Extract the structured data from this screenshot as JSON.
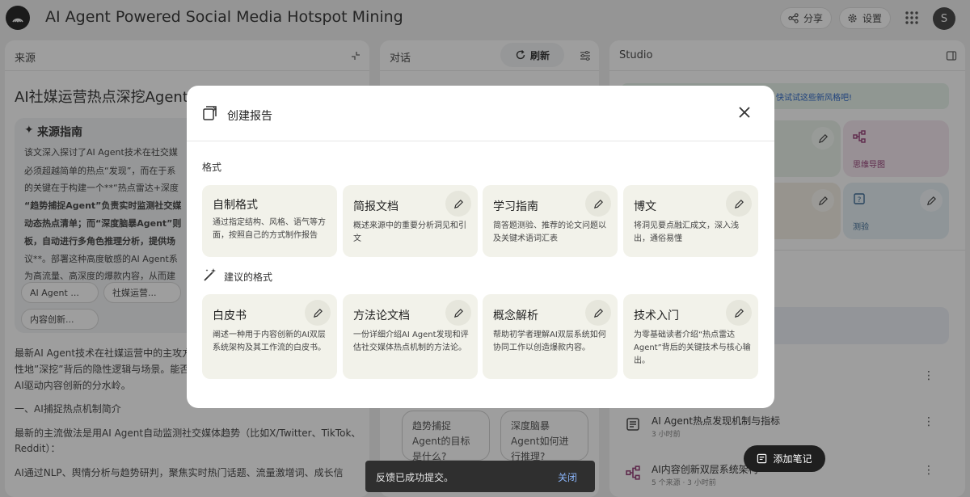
{
  "app": {
    "title": "AI Agent Powered Social Media Hotspot Mining",
    "share_label": "分享",
    "settings_label": "设置",
    "avatar_letter": "S"
  },
  "sources": {
    "panel_title": "来源",
    "doc_title": "AI社媒运营热点深挖Agent",
    "guide_title": "来源指南",
    "guide_lines": [
      "该文深入探讨了AI Agent技术在社交媒",
      "必须超越简单的热点“发现”，而在于系",
      "的关键在于构建一个**“热点雷达+深度",
      "“趋势捕捉Agent”负责实时监测社交媒",
      "动态热点清单；而“深度脑暴Agent”则",
      "板，自动进行多角色推理分析，提供场",
      "议**。部署这种高度敏感的AI Agent系",
      "为高流量、高深度的爆款内容，从而建"
    ],
    "chips": [
      "AI Agent ...",
      "社媒运营...",
      "内容创新..."
    ],
    "paragraphs": [
      "最新AI Agent技术在社媒运营中的主攻方向",
      "性地”深挖”背后的隐性逻辑与场景。能否",
      "AI驱动内容创新的分水岭。",
      "一、AI捕捉热点机制简介",
      "最新的主流做法是用AI Agent自动监测社交媒体趋势（比如X/Twitter、TikTok、",
      "Reddit）：",
      "AI通过NLP、舆情分析与趋势研判，聚焦实时热门话题、流量激增词、成长信"
    ]
  },
  "chat": {
    "panel_title": "对话",
    "refresh_label": "刷新",
    "suggestions": [
      "趋势捕捉 Agent的目标是什么?",
      "深度脑暴 Agent如何进行推理?"
    ]
  },
  "studio": {
    "panel_title": "Studio",
    "banner_text": "快试试这些新风格吧!",
    "tiles": [
      {
        "label": "思维导图"
      },
      {
        "label": "测验"
      }
    ],
    "notes": [
      {
        "title": "AI Agent热点发现机制与指标",
        "sub": "3 小时前"
      },
      {
        "title": "AI内容创新双层系统架构",
        "sub": "5 个来源 · 3 小时前"
      }
    ],
    "add_note_label": "添加笔记"
  },
  "modal": {
    "title": "创建报告",
    "section_format": "格式",
    "section_suggested": "建议的格式",
    "formats": [
      {
        "title": "自制格式",
        "desc": "通过指定结构、风格、语气等方面，按照自己的方式制作报告"
      },
      {
        "title": "简报文档",
        "desc": "概述来源中的重要分析洞见和引文"
      },
      {
        "title": "学习指南",
        "desc": "简答题测验、推荐的论文问题以及关键术语词汇表"
      },
      {
        "title": "博文",
        "desc": "将洞见要点融汇成文，深入浅出，通俗易懂"
      }
    ],
    "suggested": [
      {
        "title": "白皮书",
        "desc": "阐述一种用于内容创新的AI双层系统架构及其工作流的白皮书。"
      },
      {
        "title": "方法论文档",
        "desc": "一份详细介绍AI Agent发现和评估社交媒体热点机制的方法论。"
      },
      {
        "title": "概念解析",
        "desc": "帮助初学者理解AI双层系统如何协同工作以创造爆款内容。"
      },
      {
        "title": "技术入门",
        "desc": "为零基础读者介绍“热点雷达Agent”背后的关键技术与核心输出。"
      }
    ]
  },
  "toast": {
    "text": "反馈已成功提交。",
    "close_label": "关闭"
  }
}
